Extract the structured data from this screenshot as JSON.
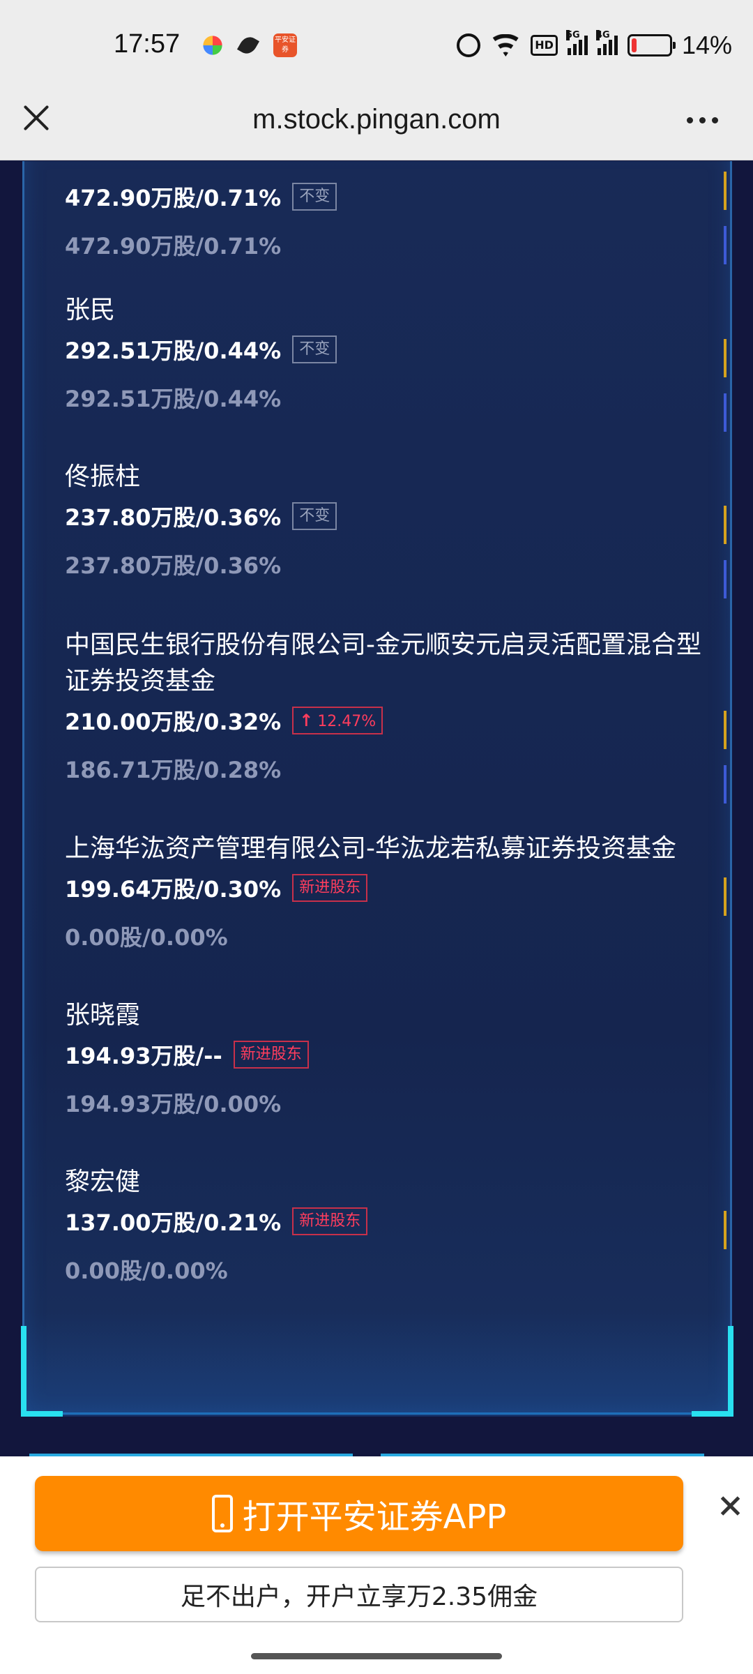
{
  "status_bar": {
    "time": "17:57",
    "battery_percent": "14%",
    "battery_level": 0.14,
    "app_icons": [
      "petal-icon",
      "feather-icon",
      "pingan-securities-icon"
    ],
    "app_icon_text": "平安证券",
    "net_labels": [
      "HD",
      "5G",
      "4G"
    ]
  },
  "browser": {
    "url": "m.stock.pingan.com"
  },
  "holders": [
    {
      "name": "",
      "current": "472.90万股/0.71%",
      "badge": "不变",
      "badge_type": "same",
      "previous": "472.90万股/0.71%"
    },
    {
      "name": "张民",
      "current": "292.51万股/0.44%",
      "badge": "不变",
      "badge_type": "same",
      "previous": "292.51万股/0.44%"
    },
    {
      "name": "佟振柱",
      "current": "237.80万股/0.36%",
      "badge": "不变",
      "badge_type": "same",
      "previous": "237.80万股/0.36%"
    },
    {
      "name": "中国民生银行股份有限公司-金元顺安元启灵活配置混合型证券投资基金",
      "current": "210.00万股/0.32%",
      "badge": "12.47%",
      "badge_type": "up",
      "previous": "186.71万股/0.28%"
    },
    {
      "name": "上海华汯资产管理有限公司-华汯龙若私募证券投资基金",
      "current": "199.64万股/0.30%",
      "badge": "新进股东",
      "badge_type": "new",
      "previous": "0.00股/0.00%"
    },
    {
      "name": "张晓霞",
      "current": "194.93万股/--",
      "badge": "新进股东",
      "badge_type": "new",
      "previous": "194.93万股/0.00%"
    },
    {
      "name": "黎宏健",
      "current": "137.00万股/0.21%",
      "badge": "新进股东",
      "badge_type": "new",
      "previous": "0.00股/0.00%"
    }
  ],
  "banner": {
    "open_app_label": "打开平安证券APP",
    "promo_text": "足不出户，开户立享万2.35佣金"
  },
  "colors": {
    "background": "#12163d",
    "panel": "#182a57",
    "accent_cyan": "#29e0f0",
    "up_red": "#ff3d5d",
    "button_orange": "#ff8a00"
  }
}
